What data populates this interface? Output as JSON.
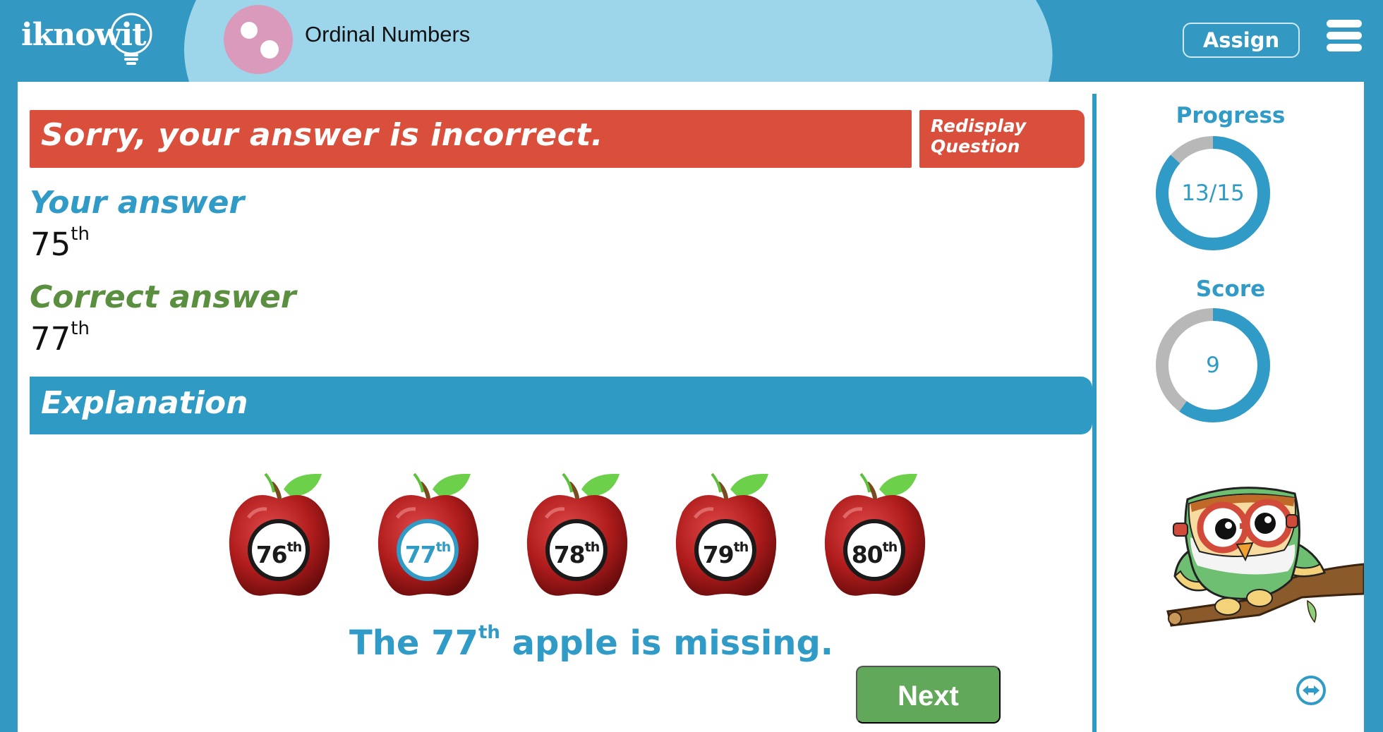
{
  "header": {
    "logo_text": "iknowit",
    "topic_title": "Ordinal Numbers",
    "topic_icon": "two-dots-icon",
    "assign_label": "Assign",
    "menu_icon": "hamburger-menu-icon"
  },
  "feedback": {
    "message": "Sorry, your answer is incorrect.",
    "redisplay_line1": "Redisplay",
    "redisplay_line2": "Question"
  },
  "answers": {
    "your_label": "Your answer",
    "your_value": "75",
    "your_suffix": "th",
    "correct_label": "Correct answer",
    "correct_value": "77",
    "correct_suffix": "th"
  },
  "explanation": {
    "heading": "Explanation",
    "apples": [
      {
        "number": "76",
        "suffix": "th",
        "highlight": false
      },
      {
        "number": "77",
        "suffix": "th",
        "highlight": true
      },
      {
        "number": "78",
        "suffix": "th",
        "highlight": false
      },
      {
        "number": "79",
        "suffix": "th",
        "highlight": false
      },
      {
        "number": "80",
        "suffix": "th",
        "highlight": false
      }
    ],
    "sentence_before": "The 77",
    "sentence_suffix": "th",
    "sentence_after": " apple is missing.",
    "next_label": "Next"
  },
  "sidebar": {
    "progress_label": "Progress",
    "progress_text": "13/15",
    "progress_done": 13,
    "progress_total": 15,
    "score_label": "Score",
    "score_text": "9",
    "score_fraction": 0.6,
    "owl_icon": "owl-mascot-icon",
    "resize_icon": "resize-horizontal-icon"
  },
  "colors": {
    "brand_blue": "#3399c3",
    "accent_blue": "#2f9bc6",
    "light_blue": "#9dd5ea",
    "incorrect_red": "#d94f3c",
    "correct_green": "#5a8f40",
    "next_green": "#61a85a",
    "ring_gray": "#b8b8b8",
    "topic_pink": "#d99abc"
  }
}
